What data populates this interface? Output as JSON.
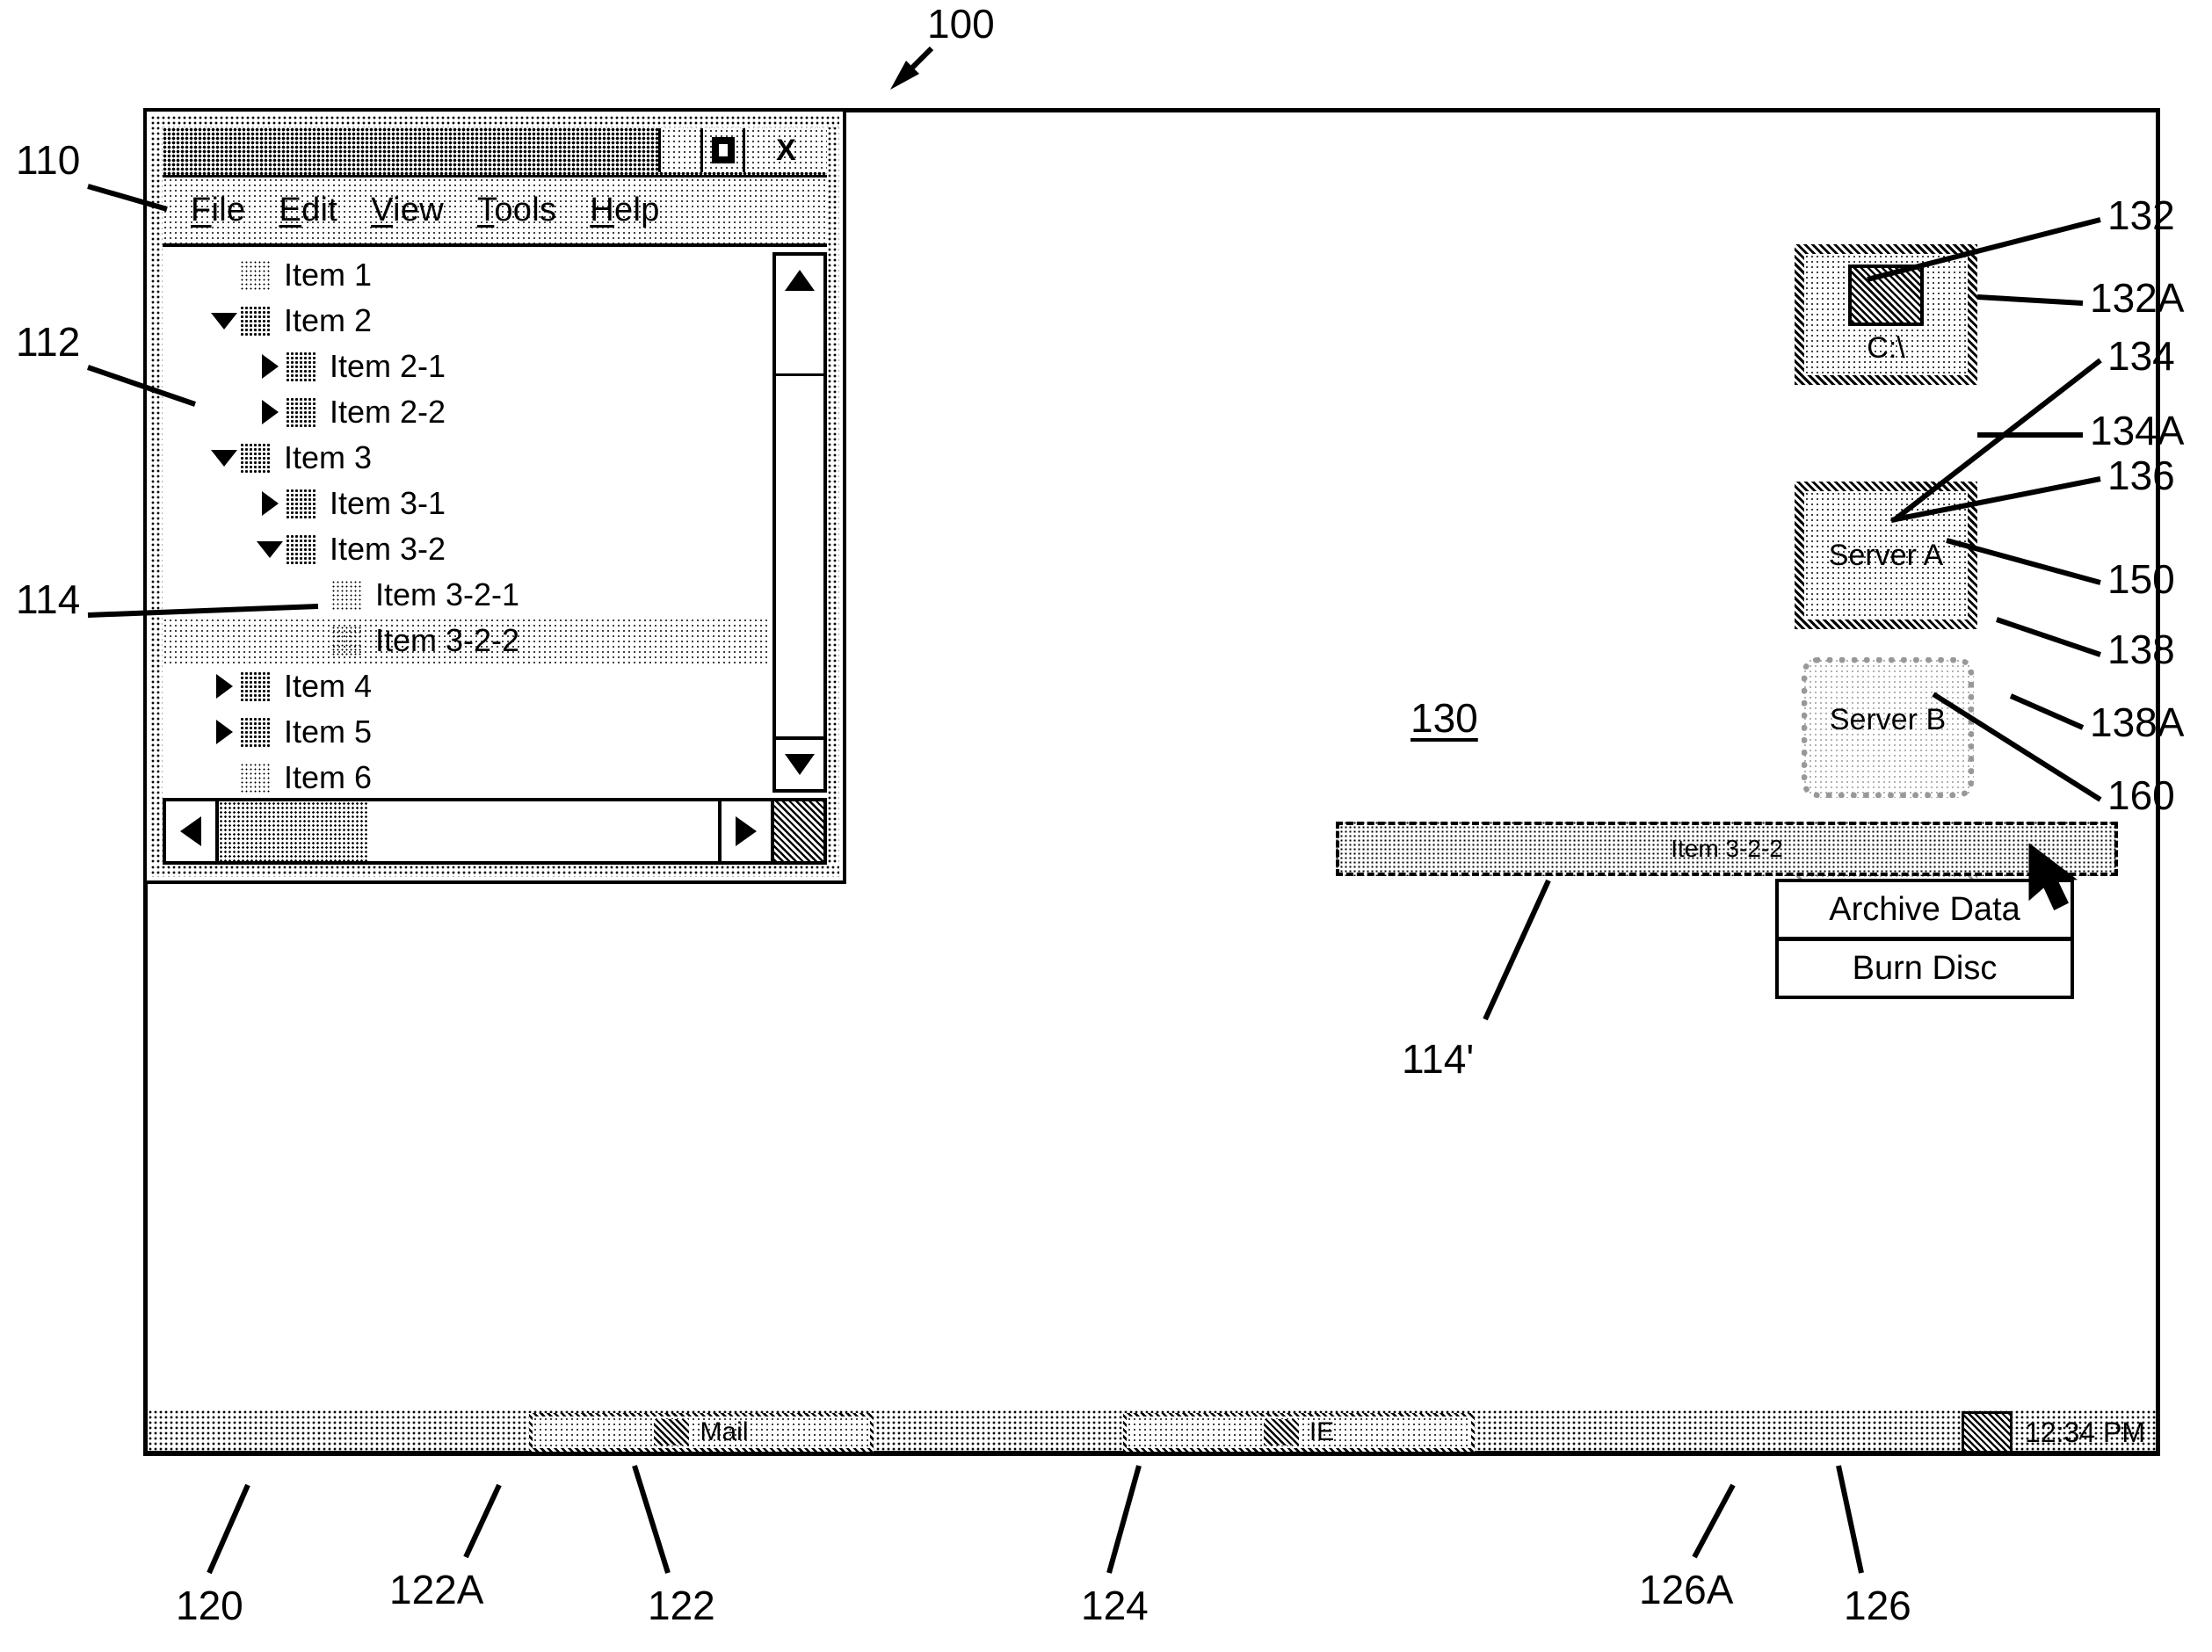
{
  "figure": {
    "main_ref": "100",
    "refs": {
      "window": "110",
      "tree_pane": "112",
      "selected_item": "114",
      "drag_ghost_item": "114'",
      "taskbar": "120",
      "task_mail": "122",
      "task_mail_icon": "122A",
      "task_ie": "124",
      "tray": "126",
      "tray_icon": "126A",
      "desktop": "130",
      "drive_icon": "132",
      "drive_icon_border": "132A",
      "server_a_icon": "134",
      "server_a_icon_border": "134A",
      "server_b_icon": "136",
      "context_menu": "138",
      "context_menu_item": "138A",
      "cursor": "150",
      "menu_region": "160"
    }
  },
  "window": {
    "title": "",
    "titlebar_buttons": [
      {
        "name": "minimize",
        "glyph": ""
      },
      {
        "name": "maximize",
        "glyph": "■"
      },
      {
        "name": "close",
        "glyph": "X"
      }
    ],
    "menubar": [
      {
        "accel": "F",
        "rest": "ile"
      },
      {
        "accel": "E",
        "rest": "dit"
      },
      {
        "accel": "V",
        "rest": "iew"
      },
      {
        "accel": "T",
        "rest": "ools"
      },
      {
        "accel": "H",
        "rest": "elp"
      }
    ]
  },
  "tree": {
    "items": [
      {
        "label": "Item 1",
        "depth": 0,
        "twisty": "none",
        "icon": "document-icon",
        "selected": false
      },
      {
        "label": "Item 2",
        "depth": 0,
        "twisty": "down",
        "icon": "folder-icon",
        "selected": false
      },
      {
        "label": "Item 2-1",
        "depth": 1,
        "twisty": "right",
        "icon": "folder-icon",
        "selected": false
      },
      {
        "label": "Item 2-2",
        "depth": 1,
        "twisty": "right",
        "icon": "folder-icon",
        "selected": false
      },
      {
        "label": "Item 3",
        "depth": 0,
        "twisty": "down",
        "icon": "folder-icon",
        "selected": false
      },
      {
        "label": "Item 3-1",
        "depth": 1,
        "twisty": "right",
        "icon": "folder-icon",
        "selected": false
      },
      {
        "label": "Item 3-2",
        "depth": 1,
        "twisty": "down",
        "icon": "folder-icon",
        "selected": false
      },
      {
        "label": "Item 3-2-1",
        "depth": 2,
        "twisty": "none",
        "icon": "document-icon",
        "selected": false
      },
      {
        "label": "Item 3-2-2",
        "depth": 2,
        "twisty": "none",
        "icon": "document-icon",
        "selected": true
      },
      {
        "label": "Item 4",
        "depth": 0,
        "twisty": "right",
        "icon": "folder-icon",
        "selected": false
      },
      {
        "label": "Item 5",
        "depth": 0,
        "twisty": "right",
        "icon": "folder-icon",
        "selected": false
      },
      {
        "label": "Item 6",
        "depth": 0,
        "twisty": "none",
        "icon": "document-icon",
        "selected": false
      }
    ]
  },
  "desktop": {
    "icons": [
      {
        "label": "C:\\",
        "name": "drive-icon",
        "style": "hatched-box",
        "faded": false
      },
      {
        "label": "Server A",
        "name": "server-a-icon",
        "style": "hatched-box",
        "faded": false
      },
      {
        "label": "Server B",
        "name": "server-b-icon",
        "style": "faded-box",
        "faded": true
      }
    ]
  },
  "drag": {
    "ghost_label": "Item 3-2-2"
  },
  "context_menu": {
    "items": [
      {
        "label": "Archive Data"
      },
      {
        "label": "Burn Disc"
      }
    ]
  },
  "taskbar": {
    "buttons": [
      {
        "label": "Mail",
        "icon": "mail-icon"
      },
      {
        "label": "IE",
        "icon": "browser-icon"
      }
    ],
    "tray": {
      "icon": "network-icon",
      "clock": "12:34 PM"
    }
  }
}
